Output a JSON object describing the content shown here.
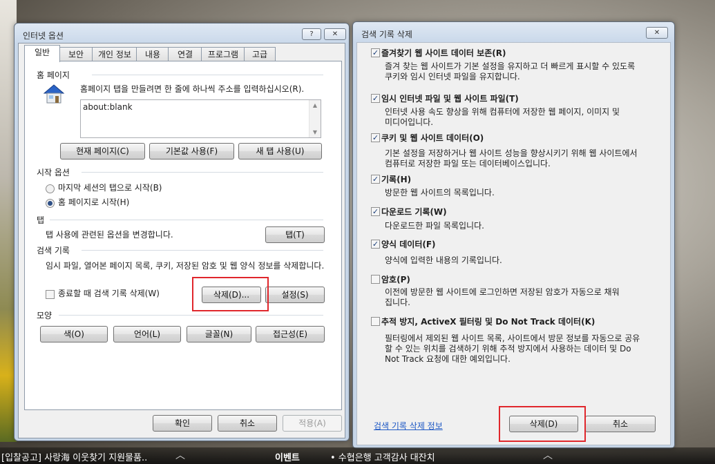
{
  "options_dialog": {
    "title": "인터넷 옵션",
    "help_button": "?",
    "close_button": "✕",
    "tabs": [
      "일반",
      "보안",
      "개인 정보",
      "내용",
      "연결",
      "프로그램",
      "고급"
    ],
    "homepage": {
      "group": "홈 페이지",
      "instruction": "홈페이지 탭을 만들려면 한 줄에 하나씩 주소를 입력하십시오(R).",
      "url": "about:blank",
      "buttons": [
        "현재 페이지(C)",
        "기본값 사용(F)",
        "새 탭 사용(U)"
      ]
    },
    "startup": {
      "group": "시작 옵션",
      "option_last_session": "마지막 세션의 탭으로 시작(B)",
      "option_homepage": "홈 페이지로 시작(H)"
    },
    "tabs_group": {
      "group": "탭",
      "description": "탭 사용에 관련된 옵션을 변경합니다.",
      "button": "탭(T)"
    },
    "history": {
      "group": "검색 기록",
      "description": "임시 파일, 열어본 페이지 목록, 쿠키, 저장된 암호 및 웹 양식 정보를 삭제합니다.",
      "delete_on_exit": "종료할 때 검색 기록 삭제(W)",
      "delete_button": "삭제(D)...",
      "settings_button": "설정(S)"
    },
    "appearance": {
      "group": "모양",
      "buttons": [
        "색(O)",
        "언어(L)",
        "글꼴(N)",
        "접근성(E)"
      ]
    },
    "footer": {
      "ok": "확인",
      "cancel": "취소",
      "apply": "적용(A)"
    }
  },
  "delete_dialog": {
    "title": "검색 기록 삭제",
    "close_button": "✕",
    "items": [
      {
        "label": "즐겨찾기 웹 사이트 데이터 보존(R)",
        "checked": true,
        "desc": [
          "즐겨 찾는 웹 사이트가 기본 설정을 유지하고 더 빠르게 표시할 수 있도록",
          "쿠키와 임시 인터넷 파일을 유지합니다."
        ]
      },
      {
        "label": "임시 인터넷 파일 및 웹 사이트 파일(T)",
        "checked": true,
        "desc": [
          "인터넷 사용 속도 향상을 위해 컴퓨터에 저장한 웹 페이지, 이미지 및",
          "미디어입니다."
        ]
      },
      {
        "label": "쿠키 및 웹 사이트 데이터(O)",
        "checked": true,
        "desc": [
          "기본 설정을 저장하거나 웹 사이트 성능을 향상시키기 위해 웹 사이트에서",
          "컴퓨터로 저장한 파일 또는 데이터베이스입니다."
        ]
      },
      {
        "label": "기록(H)",
        "checked": true,
        "desc": [
          "방문한 웹 사이트의 목록입니다."
        ]
      },
      {
        "label": "다운로드 기록(W)",
        "checked": true,
        "desc": [
          "다운로드한 파일 목록입니다."
        ]
      },
      {
        "label": "양식 데이터(F)",
        "checked": true,
        "desc": [
          "양식에 입력한 내용의 기록입니다."
        ]
      },
      {
        "label": "암호(P)",
        "checked": false,
        "desc": [
          "이전에 방문한 웹 사이트에 로그인하면 저장된 암호가 자동으로 채워",
          "집니다."
        ]
      },
      {
        "label": "추적 방지, ActiveX 필터링 및 Do Not Track 데이터(K)",
        "checked": false,
        "desc": [
          "필터링에서 제외된 웹 사이트 목록, 사이트에서 방문 정보를 자동으로 공유",
          "할 수 있는 위치를 검색하기 위해 추적 방지에서 사용하는 데이터 및 Do",
          "Not Track 요청에 대한 예외입니다."
        ]
      }
    ],
    "info_link": "검색 기록 삭제 정보",
    "delete_button": "삭제(D)",
    "cancel_button": "취소"
  },
  "ticker": {
    "item1": "[입찰공고] 사랑海 이웃찾기 지원물품..",
    "item2": "이벤트",
    "item3": "• 수협은행 고객감사 대잔치",
    "chevron": "︿"
  },
  "colors": {
    "highlight": "#e0262b",
    "check": "#1c3f7a",
    "link": "#1c57c4"
  }
}
